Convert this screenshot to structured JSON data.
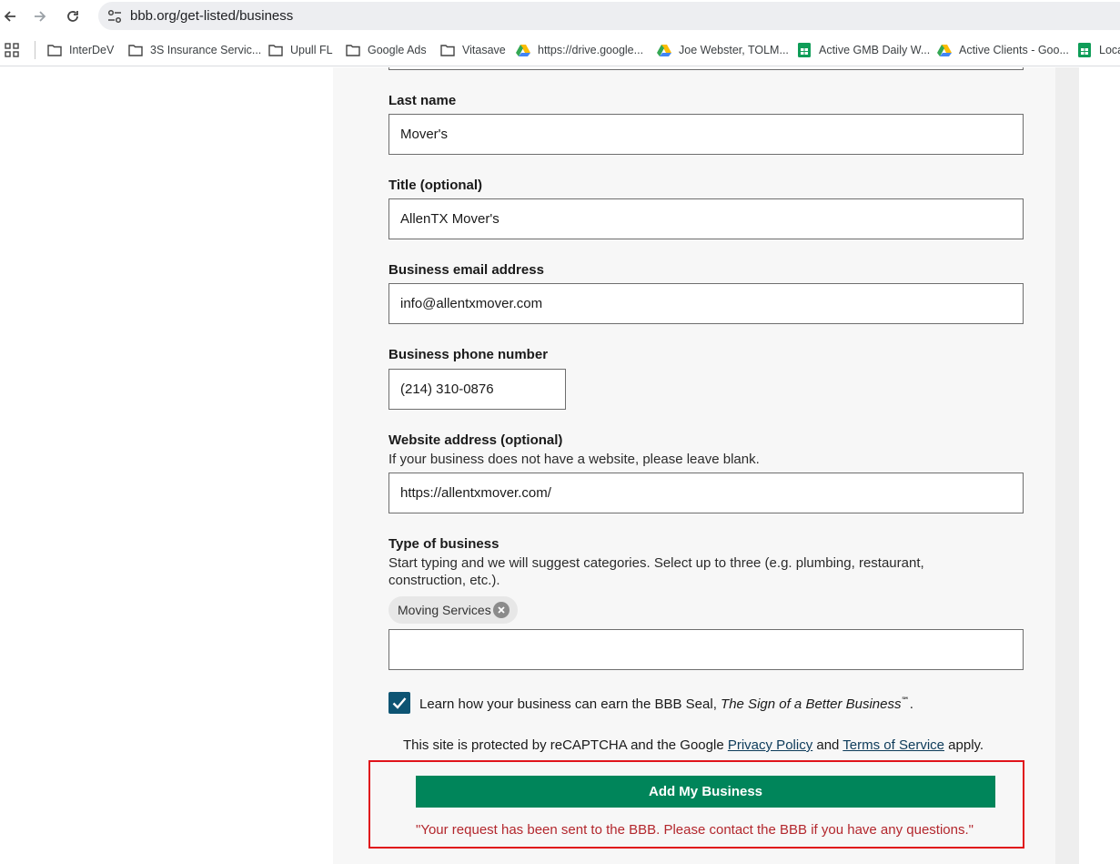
{
  "browser": {
    "url": "bbb.org/get-listed/business",
    "bookmarks": [
      {
        "label": "InterDeV",
        "icon": "folder-icon"
      },
      {
        "label": "3S Insurance Servic...",
        "icon": "folder-icon"
      },
      {
        "label": "Upull FL",
        "icon": "folder-icon"
      },
      {
        "label": "Google Ads",
        "icon": "folder-icon"
      },
      {
        "label": "Vitasave",
        "icon": "folder-icon"
      },
      {
        "label": "https://drive.google...",
        "icon": "drive-icon"
      },
      {
        "label": "Joe Webster, TOLM...",
        "icon": "drive-icon"
      },
      {
        "label": "Active GMB Daily W...",
        "icon": "sheets-icon"
      },
      {
        "label": "Active Clients - Goo...",
        "icon": "drive-icon"
      },
      {
        "label": "Loca",
        "icon": "sheets-icon"
      }
    ]
  },
  "form": {
    "last_name": {
      "label": "Last name",
      "value": "Mover's"
    },
    "title": {
      "label": "Title (optional)",
      "value": "AllenTX Mover's"
    },
    "email": {
      "label": "Business email address",
      "value": "info@allentxmover.com"
    },
    "phone": {
      "label": "Business phone number",
      "value": "(214) 310-0876"
    },
    "website": {
      "label": "Website address (optional)",
      "hint": "If your business does not have a website, please leave blank.",
      "value": "https://allentxmover.com/"
    },
    "business_type": {
      "label": "Type of business",
      "hint_line1": "Start typing and we will suggest categories. Select up to three (e.g. plumbing, restaurant,",
      "hint_line2": "construction, etc.).",
      "chips": [
        "Moving Services"
      ],
      "value": ""
    },
    "seal_checkbox": {
      "checked": true,
      "text": "Learn how your business can earn the BBB Seal, ",
      "italic": "The Sign of a Better Business",
      "mark": "℠",
      "end": "."
    },
    "recaptcha": {
      "prefix": "This site is protected by reCAPTCHA and the Google ",
      "privacy": "Privacy Policy",
      "and": " and ",
      "terms": "Terms of Service",
      "suffix": " apply."
    },
    "submit_label": "Add My Business",
    "status_message": "\"Your request has been sent to the BBB. Please contact the BBB if you have any questions.\""
  },
  "colors": {
    "submit": "#00855a",
    "checkbox": "#0d5473",
    "status": "#b3272d",
    "highlight": "#e0141b"
  }
}
